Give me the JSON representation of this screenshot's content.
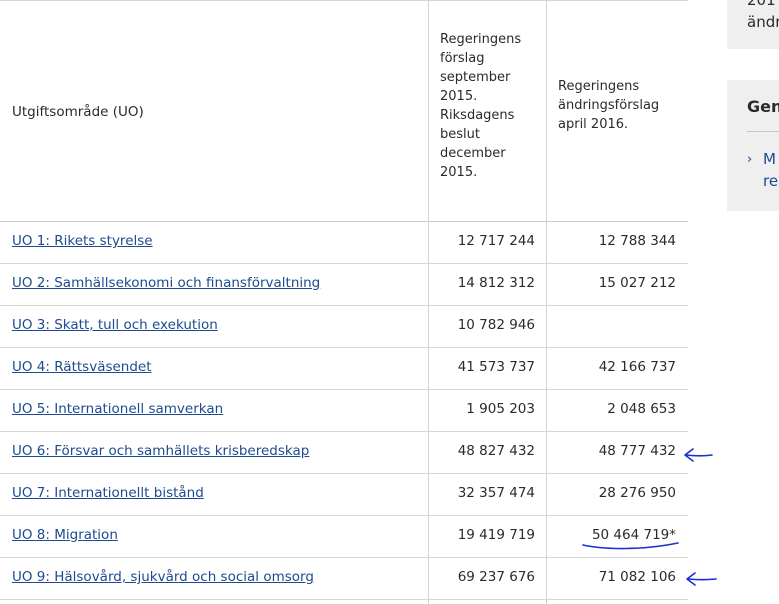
{
  "table": {
    "header": {
      "area_label": "Utgiftsområde (UO)",
      "col1": [
        "Regeringens",
        "förslag",
        "september",
        "2015.",
        "Riksdagens",
        "beslut",
        "december",
        "2015."
      ],
      "col2": [
        "Regeringens",
        "ändringsförslag",
        "april 2016."
      ]
    },
    "rows": [
      {
        "label": "UO 1: Rikets styrelse",
        "v1": "12 717 244",
        "v2": "12 788 344"
      },
      {
        "label": "UO 2: Samhällsekonomi och finansförvaltning",
        "v1": "14 812 312",
        "v2": "15 027 212"
      },
      {
        "label": "UO 3: Skatt, tull och exekution",
        "v1": "10 782 946",
        "v2": ""
      },
      {
        "label": "UO 4: Rättsväsendet",
        "v1": "41 573 737",
        "v2": "42 166 737"
      },
      {
        "label": "UO 5: Internationell samverkan",
        "v1": "1 905 203",
        "v2": "2 048 653"
      },
      {
        "label": "UO 6: Försvar och samhällets krisberedskap",
        "v1": "48 827 432",
        "v2": "48 777 432"
      },
      {
        "label": "UO 7: Internationellt bistånd",
        "v1": "32 357 474",
        "v2": "28 276 950"
      },
      {
        "label": "UO 8: Migration",
        "v1": "19 419 719",
        "v2": "50 464 719*"
      },
      {
        "label": "UO 9: Hälsovård, sjukvård och social omsorg",
        "v1": "69 237 676",
        "v2": "71 082 106"
      }
    ]
  },
  "sidebar": {
    "card1_lines": [
      "201",
      "ändr"
    ],
    "card2_heading": "Gen",
    "card2_link_lines": [
      "M",
      "re"
    ]
  },
  "colors": {
    "link": "#1d4b8f",
    "annotation": "#1a2fd6",
    "card_bg": "#efefef"
  }
}
